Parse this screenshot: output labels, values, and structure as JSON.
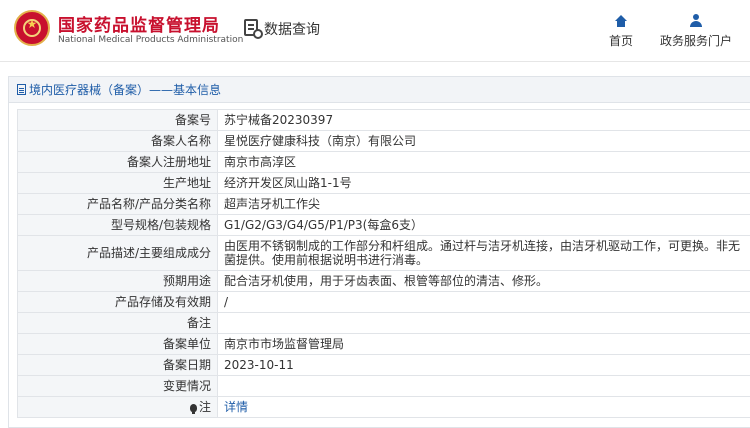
{
  "header": {
    "org_name_cn": "国家药品监督管理局",
    "org_name_en": "National Medical Products Administration",
    "search_title": "数据查询",
    "nav": [
      {
        "label": "首页",
        "icon": "home-icon"
      },
      {
        "label": "政务服务门户",
        "icon": "user-icon"
      }
    ]
  },
  "section": {
    "title": "境内医疗器械（备案）——基本信息"
  },
  "record": {
    "rows": [
      {
        "key": "备案号",
        "value": "苏宁械备20230397"
      },
      {
        "key": "备案人名称",
        "value": "星悦医疗健康科技（南京）有限公司"
      },
      {
        "key": "备案人注册地址",
        "value": "南京市高淳区"
      },
      {
        "key": "生产地址",
        "value": "经济开发区凤山路1-1号"
      },
      {
        "key": "产品名称/产品分类名称",
        "value": "超声洁牙机工作尖"
      },
      {
        "key": "型号规格/包装规格",
        "value": "G1/G2/G3/G4/G5/P1/P3(每盒6支）"
      },
      {
        "key": "产品描述/主要组成成分",
        "value": "由医用不锈钢制成的工作部分和杆组成。通过杆与洁牙机连接，由洁牙机驱动工作，可更换。非无菌提供。使用前根据说明书进行消毒。"
      },
      {
        "key": "预期用途",
        "value": "配合洁牙机使用，用于牙齿表面、根管等部位的清洁、修形。"
      },
      {
        "key": "产品存储及有效期",
        "value": "/"
      },
      {
        "key": "备注",
        "value": ""
      },
      {
        "key": "备案单位",
        "value": "南京市市场监督管理局"
      },
      {
        "key": "备案日期",
        "value": "2023-10-11"
      },
      {
        "key": "变更情况",
        "value": ""
      }
    ],
    "note_key": "注",
    "note_link": "详情"
  }
}
